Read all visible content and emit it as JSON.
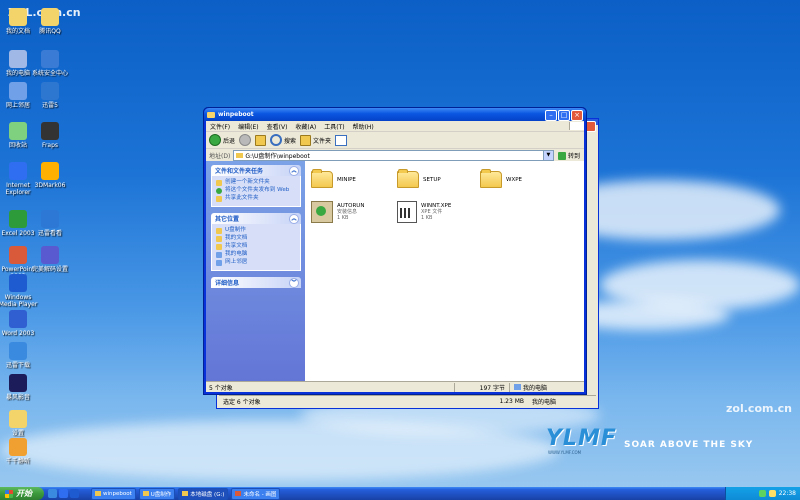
{
  "watermarks": {
    "top_left": "ZOL.com.cn",
    "bottom_right": "zol.com.cn"
  },
  "desktop_icons": [
    {
      "label": "我的文档",
      "color": "#f2d46b"
    },
    {
      "label": "腾讯QQ",
      "color": "#f2d46b"
    },
    {
      "label": "我的电脑",
      "color": "#9fb8e6"
    },
    {
      "label": "系统安全中心",
      "color": "#3a7bd5"
    },
    {
      "label": "网上邻居",
      "color": "#6fa0e8"
    },
    {
      "label": "迅雷5",
      "color": "#2e77d0"
    },
    {
      "label": "回收站",
      "color": "#7fd07f"
    },
    {
      "label": "Fraps",
      "color": "#333333"
    },
    {
      "label": "Internet Explorer",
      "color": "#2f6ef0"
    },
    {
      "label": "3DMark06",
      "color": "#ffb000"
    },
    {
      "label": "Excel 2003",
      "color": "#2e9b3b"
    },
    {
      "label": "迅雷看看",
      "color": "#2c78d4"
    },
    {
      "label": "PowerPoint 2003",
      "color": "#d9593b"
    },
    {
      "label": "完美解码设置",
      "color": "#5a5ad0"
    },
    {
      "label": "Windows Media Player",
      "color": "#1e5bd0"
    },
    {
      "label": "Word 2003",
      "color": "#2f5fd0"
    },
    {
      "label": "迅雷下载",
      "color": "#3a8ae0"
    },
    {
      "label": "暴风影音",
      "color": "#1c1c5a"
    },
    {
      "label": "设置",
      "color": "#f2d46b"
    },
    {
      "label": "千千静听",
      "color": "#f0a030"
    }
  ],
  "logo": {
    "brand": "YLMF",
    "slogan": "SOAR ABOVE THE SKY",
    "tagline": "WWW.YLMF.COM"
  },
  "back_window": {
    "status_left": "选定 6 个对象",
    "status_size": "1.23 MB",
    "status_location": "我的电脑"
  },
  "window": {
    "title": "winpeboot",
    "menu": [
      "文件(F)",
      "编辑(E)",
      "查看(V)",
      "收藏(A)",
      "工具(T)",
      "帮助(H)"
    ],
    "toolbar": {
      "back": "后退",
      "search": "搜索",
      "folders": "文件夹"
    },
    "address": {
      "label": "地址(D)",
      "value": "G:\\U盘制作\\winpeboot",
      "go": "转到"
    },
    "tasks_panel": {
      "title": "文件和文件夹任务",
      "items": [
        "创建一个新文件夹",
        "将这个文件夹发布到 Web",
        "共享此文件夹"
      ]
    },
    "other_places": {
      "title": "其它位置",
      "items": [
        "U盘制作",
        "我的文档",
        "共享文档",
        "我的电脑",
        "网上邻居"
      ]
    },
    "details": {
      "title": "详细信息"
    },
    "files": [
      {
        "name": "MINIPE",
        "type": "folder"
      },
      {
        "name": "SETUP",
        "type": "folder"
      },
      {
        "name": "WXPE",
        "type": "folder"
      },
      {
        "name": "AUTORUN",
        "sub1": "安装信息",
        "sub2": "1 KB",
        "type": "setup"
      },
      {
        "name": "WINNT.XPE",
        "sub1": "XPE 文件",
        "sub2": "1 KB",
        "type": "file"
      }
    ],
    "status": {
      "count": "5 个对象",
      "size": "197 字节",
      "location": "我的电脑"
    }
  },
  "taskbar": {
    "start": "开始",
    "tasks": [
      "winpeboot",
      "U盘制作",
      "本地磁盘 (G:)",
      "未命名 - 画图"
    ],
    "clock": "22:38"
  }
}
